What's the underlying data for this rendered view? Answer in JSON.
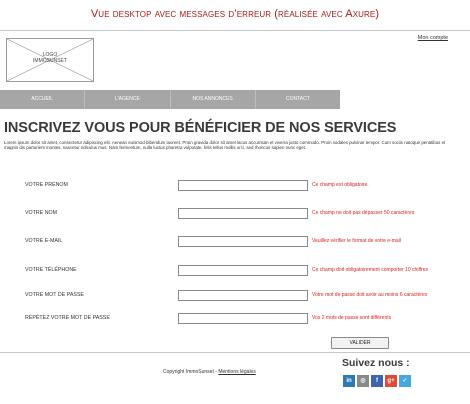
{
  "caption": "Vue desktop avec messages d’erreur (réalisée avec Axure)",
  "header": {
    "logo_line1": "LOGO",
    "logo_line2": "IMMOSUNSET",
    "account_link": "Mon compte"
  },
  "nav": {
    "items": [
      "ACCUEIL",
      "L'AGENCE",
      "NOS ANNONCES",
      "CONTACT"
    ]
  },
  "main": {
    "title": "INSCRIVEZ VOUS POUR BÉNÉFICIER DE NOS SERVICES",
    "intro": "Lorem ipsum dolor sit amet, consectetur adipiscing elit. Aenean euismod bibendum laoreet. Proin gravida dolor sit amet lacus accumsan et viverra justo commodo. Proin sodales pulvinar tempor. Cum sociis natoque penatibus et magnis dis parturient montes, nascetur ridiculus mus. Nam fermentum, nulla luctus pharetra vulputate, felis tellus mollis orci, sed rhoncus sapien nunc eget."
  },
  "form": {
    "fields": [
      {
        "label": "VOTRE PRÉNOM",
        "value": "",
        "error": "Ce champ est obligatoire."
      },
      {
        "label": "VOTRE NOM",
        "value": "",
        "error": "Ce champ ne doit pas dépasser 50 caractères"
      },
      {
        "label": "VOTRE E-MAIL",
        "value": "",
        "error": "Veuillez vérifier le format de votre e-mail"
      },
      {
        "label": "VOTRE TÉLÉPHONE",
        "value": "",
        "error": "Ce champ doit obligatoirement comporter 10 chiffres"
      },
      {
        "label": "VOTRE MOT DE PASSE",
        "value": "",
        "error": "Votre mot de passe doit avoir au moins 6 caractères"
      },
      {
        "label": "RÉPÉTEZ VOTRE MOT DE PASSE",
        "value": "",
        "error": "Vos 2 mots de passe sont différents"
      }
    ],
    "submit_label": "VALIDER"
  },
  "footer": {
    "copyright": "Copyright ImmoSunset -",
    "legal_link": "Mentions légales",
    "follow_title": "Suivez nous :",
    "socials": [
      {
        "icon": "linkedin-icon",
        "glyph": "in",
        "color": "#2c7ab8"
      },
      {
        "icon": "instagram-icon",
        "glyph": "◎",
        "color": "#8a8a8a"
      },
      {
        "icon": "facebook-icon",
        "glyph": "f",
        "color": "#3f63b0"
      },
      {
        "icon": "googleplus-icon",
        "glyph": "g+",
        "color": "#dd4b39"
      },
      {
        "icon": "twitter-icon",
        "glyph": "✓",
        "color": "#4aa8e0"
      }
    ]
  },
  "colors": {
    "caption": "#a81a1a",
    "error": "#e02020",
    "nav_bg": "#a6a6a6"
  }
}
